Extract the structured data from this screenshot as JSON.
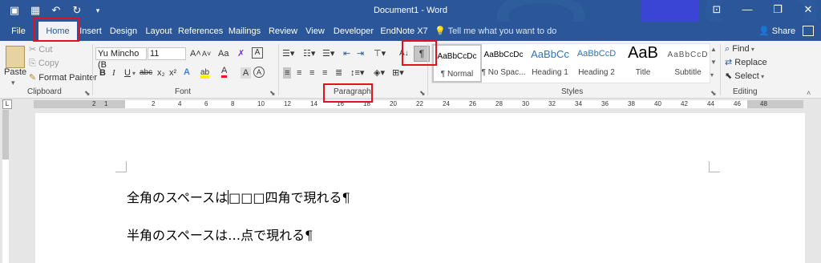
{
  "window": {
    "title": "Document1 - Word",
    "quick_access": [
      {
        "name": "save-icon",
        "glyph": "▣"
      },
      {
        "name": "layout-icon",
        "glyph": "▦"
      },
      {
        "name": "undo-icon",
        "glyph": "↶"
      },
      {
        "name": "redo-icon",
        "glyph": "↻"
      },
      {
        "name": "customize-qat-icon",
        "glyph": "▾"
      }
    ],
    "controls": {
      "ribbon_display": "⊡",
      "minimize": "—",
      "restore": "❐",
      "close": "✕"
    }
  },
  "tabs": {
    "file": "File",
    "home": "Home",
    "insert": "Insert",
    "design": "Design",
    "layout": "Layout",
    "references": "References",
    "mailings": "Mailings",
    "review": "Review",
    "view": "View",
    "developer": "Developer",
    "endnote": "EndNote X7",
    "active": "home"
  },
  "tell_me": {
    "icon": "lightbulb-icon",
    "placeholder": "Tell me what you want to do"
  },
  "share": {
    "label": "Share"
  },
  "clipboard": {
    "paste": "Paste",
    "cut": "Cut",
    "copy": "Copy",
    "format_painter": "Format Painter",
    "label": "Clipboard"
  },
  "font": {
    "name": "Yu Mincho (B",
    "size": "11",
    "grow": "A˄",
    "shrink": "A˅",
    "change_case": "Aa",
    "clear_format": "A",
    "bold": "B",
    "italic": "I",
    "underline": "U",
    "strike": "abc",
    "subscript": "x₂",
    "superscript": "x²",
    "label": "Font"
  },
  "paragraph": {
    "label": "Paragraph",
    "show_hide": "¶",
    "sort": "A↓"
  },
  "styles": {
    "label": "Styles",
    "items": [
      {
        "sample": "AaBbCcDc",
        "name": "¶ Normal"
      },
      {
        "sample": "AaBbCcDc",
        "name": "¶ No Spac..."
      },
      {
        "sample": "AaBbCc",
        "name": "Heading 1"
      },
      {
        "sample": "AaBbCcD",
        "name": "Heading 2"
      },
      {
        "sample": "AaB",
        "name": "Title"
      },
      {
        "sample": "AaBbCcD",
        "name": "Subtitle"
      }
    ]
  },
  "editing": {
    "find": "Find",
    "replace": "Replace",
    "select": "Select",
    "label": "Editing"
  },
  "ruler": {
    "numbers": [
      "2",
      "1",
      "2",
      "4",
      "6",
      "8",
      "10",
      "12",
      "14",
      "16",
      "18",
      "20",
      "22",
      "24",
      "26",
      "28",
      "30",
      "32",
      "34",
      "36",
      "38",
      "40",
      "42",
      "44",
      "46",
      "48"
    ]
  },
  "document": {
    "line1_before": "全角のスペースは",
    "line1_after": "□□□四角で現れる¶",
    "line2": "半角のスペースは…点で現れる¶"
  },
  "colors": {
    "title_bar": "#2b579a",
    "highlight_box": "#e0121f",
    "ribbon_bg": "#f3f3f3"
  }
}
